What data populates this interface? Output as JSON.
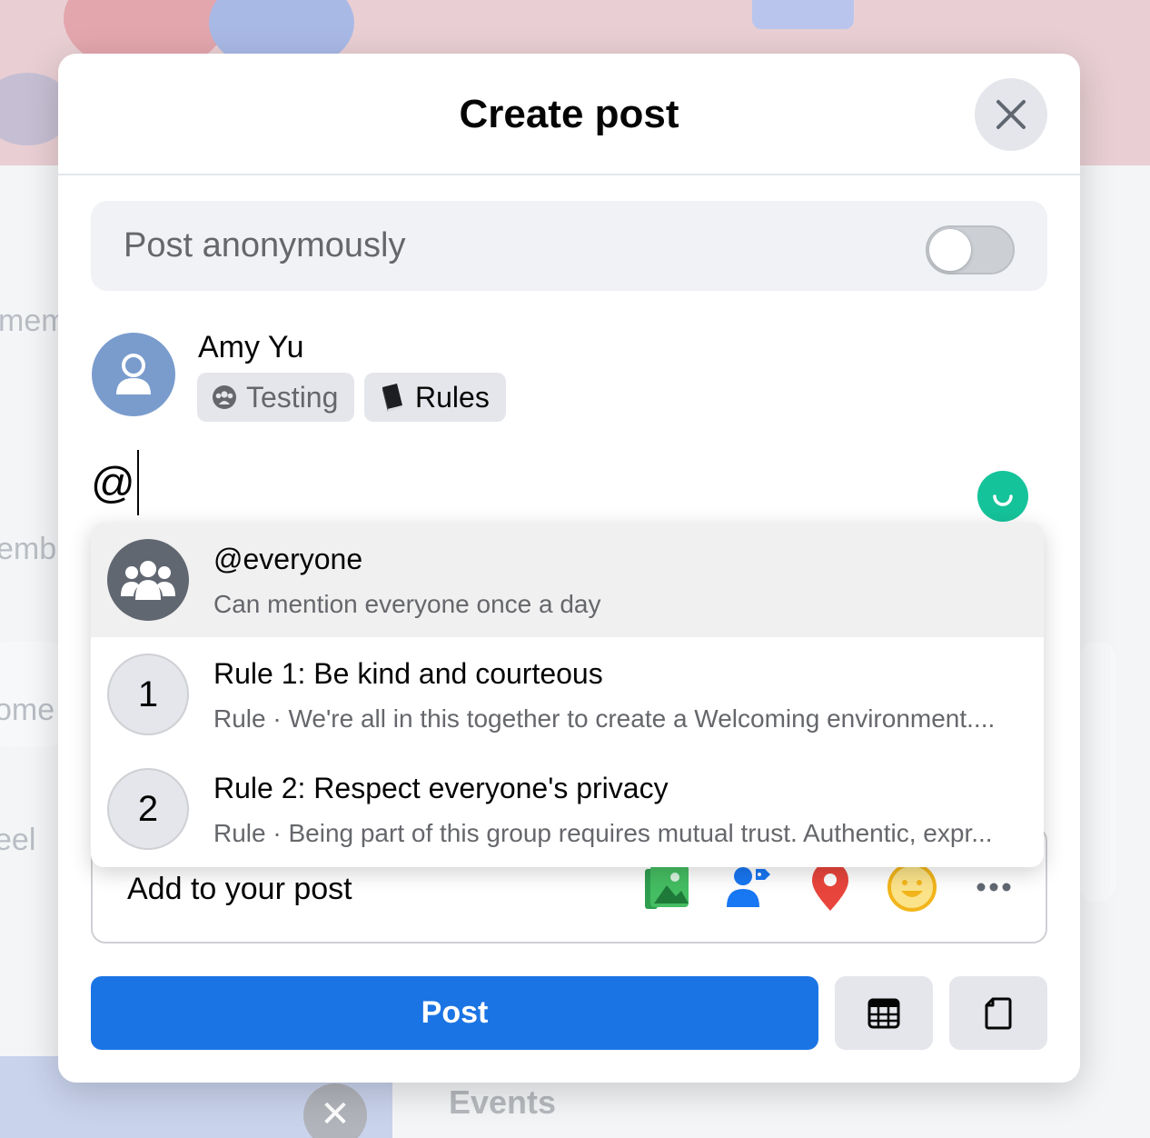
{
  "dialog": {
    "title": "Create post",
    "close_label": "Close"
  },
  "anonymous": {
    "label": "Post anonymously",
    "enabled": false
  },
  "author": {
    "name": "Amy Yu",
    "audience_chip": "Testing",
    "rules_chip": "Rules"
  },
  "composer": {
    "value": "@"
  },
  "mention_suggestions": [
    {
      "title": "@everyone",
      "subtitle": "Can mention everyone once a day",
      "icon": "group-icon",
      "highlighted": true
    },
    {
      "number": "1",
      "title": "Rule 1: Be kind and courteous",
      "subtitle": "Rule · We're all in this together to create a Welcoming environment....",
      "icon": "number-badge"
    },
    {
      "number": "2",
      "title": "Rule 2: Respect everyone's privacy",
      "subtitle": "Rule · Being part of this group requires mutual trust. Authentic, expr...",
      "icon": "number-badge"
    }
  ],
  "add_to_post": {
    "label": "Add to your post",
    "icons": [
      "photo-video-icon",
      "tag-people-icon",
      "location-pin-icon",
      "feeling-emoji-icon",
      "more-icon"
    ]
  },
  "actions": {
    "post_label": "Post",
    "schedule_icon": "calendar-icon",
    "drafts_icon": "document-icon"
  },
  "background": {
    "fragments": [
      "mem",
      "emb",
      "ome",
      "eel"
    ],
    "events_label": "Events"
  },
  "colors": {
    "primary": "#1b74e4",
    "grammar": "#15c39a",
    "location": "#e8453c",
    "feeling": "#f2b51b",
    "photo": "#45bd62",
    "tag": "#1877f2"
  }
}
